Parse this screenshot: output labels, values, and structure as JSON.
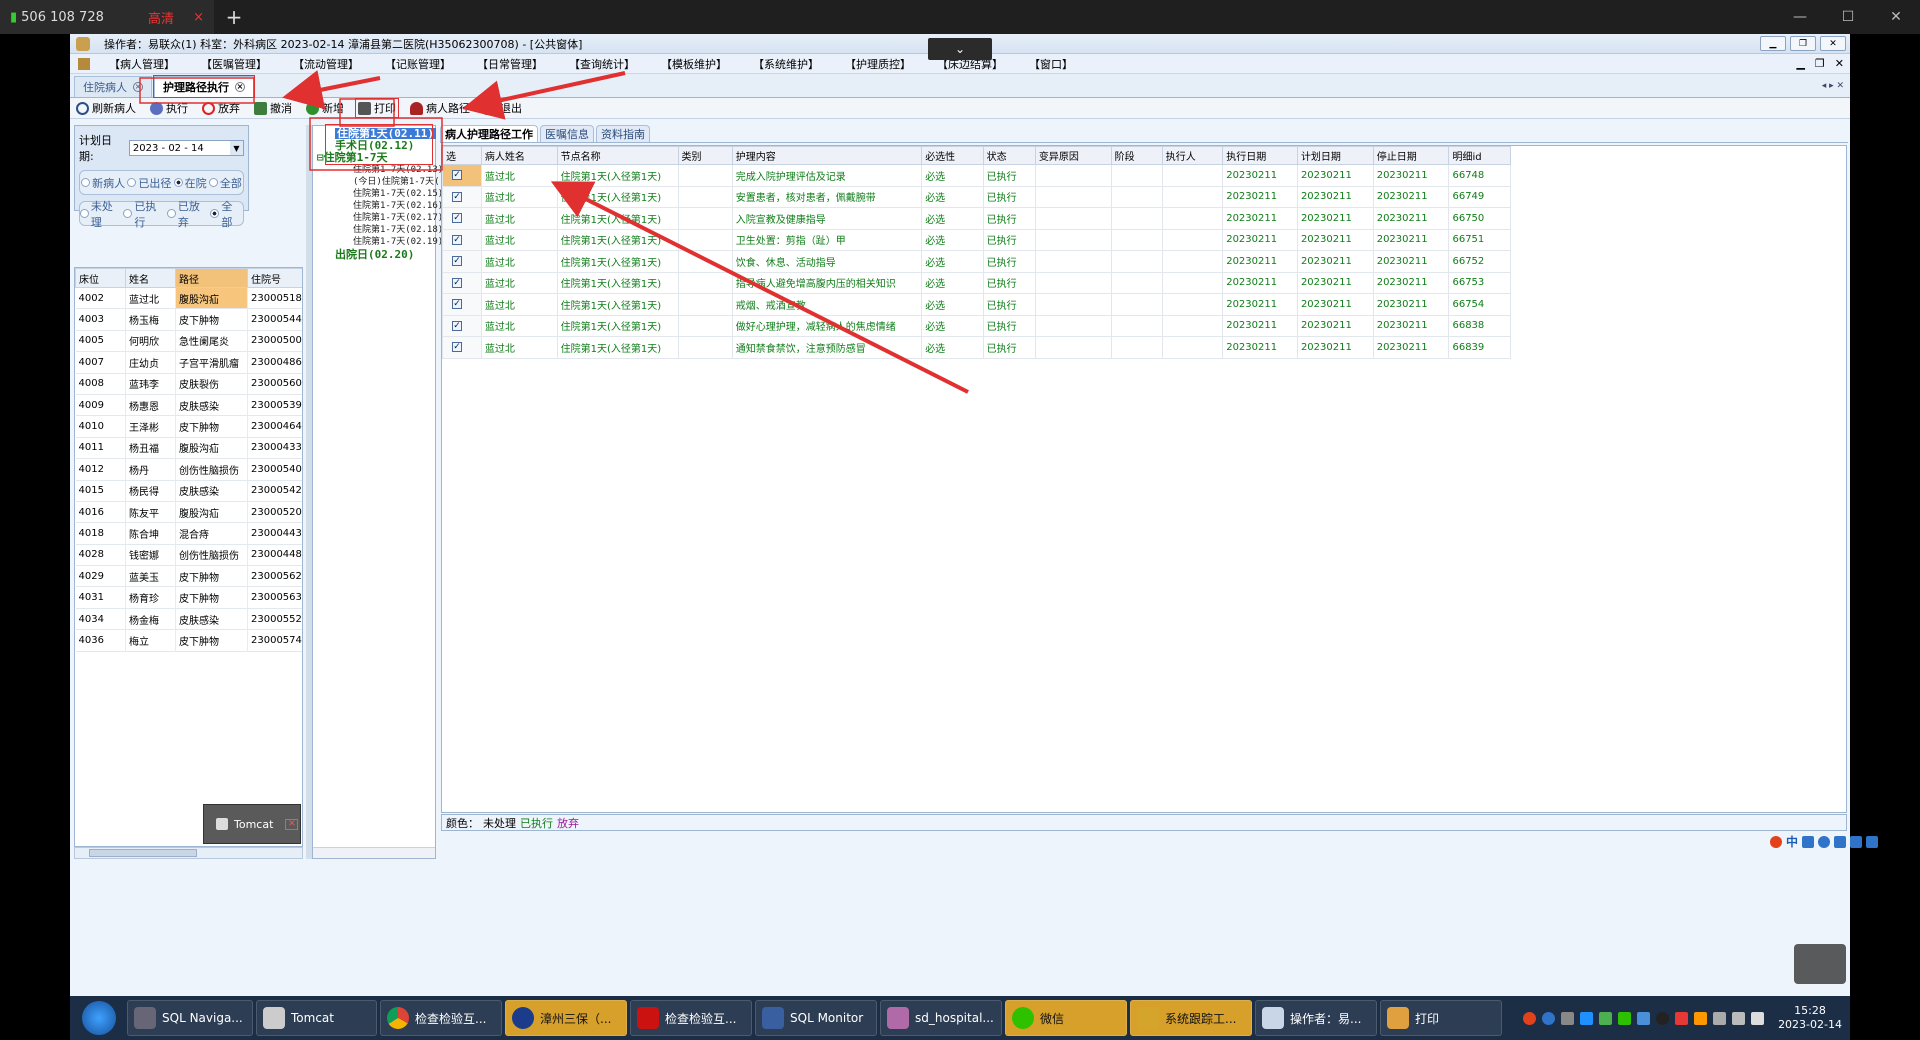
{
  "browser": {
    "tab_signal": "506 108 728",
    "tab_quality": "高清",
    "close": "×",
    "new_tab": "+"
  },
  "app": {
    "title": "操作者：易联众(1)  科室：外科病区  2023-02-14  漳浦县第二医院(H35062300708) - [公共窗体]",
    "menu": [
      "【病人管理】",
      "【医嘱管理】",
      "【流动管理】",
      "【记账管理】",
      "【日常管理】",
      "【查询统计】",
      "【模板维护】",
      "【系统维护】",
      "【护理质控】",
      "【床边结算】",
      "【窗口】"
    ],
    "page_tabs": [
      {
        "label": "住院病人"
      },
      {
        "label": "护理路径执行"
      }
    ],
    "toolbar": [
      "刷新病人",
      "执行",
      "放弃",
      "撤消",
      "新增",
      "打印",
      "病人路径",
      "退出"
    ],
    "filter": {
      "date_label": "计划日期:",
      "date_value": "2023 - 02 - 14",
      "radio1": [
        "新病人",
        "已出径",
        "在院",
        "全部"
      ],
      "radio1_selected": "在院",
      "radio2": [
        "未处理",
        "已执行",
        "已放弃",
        "全部"
      ],
      "radio2_selected": "全部"
    },
    "patients": {
      "headers": [
        "床位",
        "姓名",
        "路径",
        "住院号"
      ],
      "rows": [
        [
          "4002",
          "蓝过北",
          "腹股沟疝",
          "23000518"
        ],
        [
          "4003",
          "杨玉梅",
          "皮下肿物",
          "23000544"
        ],
        [
          "4005",
          "何明欣",
          "急性阑尾炎",
          "23000500"
        ],
        [
          "4007",
          "庄幼贞",
          "子宫平滑肌瘤",
          "23000486"
        ],
        [
          "4008",
          "蓝玮李",
          "皮肤裂伤",
          "23000560"
        ],
        [
          "4009",
          "杨惠恩",
          "皮肤感染",
          "23000539"
        ],
        [
          "4010",
          "王泽彬",
          "皮下肿物",
          "23000464"
        ],
        [
          "4011",
          "杨丑福",
          "腹股沟疝",
          "23000433"
        ],
        [
          "4012",
          "杨丹",
          "创伤性脑损伤",
          "23000540"
        ],
        [
          "4015",
          "杨民得",
          "皮肤感染",
          "23000542"
        ],
        [
          "4016",
          "陈友平",
          "腹股沟疝",
          "23000520"
        ],
        [
          "4018",
          "陈合坤",
          "混合痔",
          "23000443"
        ],
        [
          "4028",
          "钱密娜",
          "创伤性脑损伤",
          "23000448"
        ],
        [
          "4029",
          "蓝美玉",
          "皮下肿物",
          "23000562"
        ],
        [
          "4031",
          "杨育珍",
          "皮下肿物",
          "23000563"
        ],
        [
          "4034",
          "杨金梅",
          "皮肤感染",
          "23000552"
        ],
        [
          "4036",
          "梅立",
          "皮下肿物",
          "23000574"
        ]
      ]
    },
    "tomcat_popup": "Tomcat",
    "tree": {
      "items": [
        "住院第1天(02.11)",
        "手术日(02.12)",
        "住院第1-7天",
        "住院第1-7天(02.13)",
        "(今日)住院第1-7天(",
        "住院第1-7天(02.15)",
        "住院第1-7天(02.16)",
        "住院第1-7天(02.17)",
        "住院第1-7天(02.18)",
        "住院第1-7天(02.19)",
        "出院日(02.20)"
      ]
    },
    "subtabs": [
      "病人护理路径工作",
      "医嘱信息",
      "资料指南"
    ],
    "grid": {
      "headers": [
        "选",
        "病人姓名",
        "节点名称",
        "类别",
        "护理内容",
        "必选性",
        "状态",
        "变异原因",
        "阶段",
        "执行人",
        "执行日期",
        "计划日期",
        "停止日期",
        "明细id"
      ],
      "rows": [
        [
          "✓",
          "蓝过北",
          "住院第1天(入径第1天)",
          "",
          "完成入院护理评估及记录",
          "必选",
          "已执行",
          "",
          "",
          "",
          "20230211",
          "20230211",
          "20230211",
          "66748"
        ],
        [
          "✓",
          "蓝过北",
          "住院第1天(入径第1天)",
          "",
          "安置患者，核对患者，佩戴腕带",
          "必选",
          "已执行",
          "",
          "",
          "",
          "20230211",
          "20230211",
          "20230211",
          "66749"
        ],
        [
          "✓",
          "蓝过北",
          "住院第1天(入径第1天)",
          "",
          "入院宣教及健康指导",
          "必选",
          "已执行",
          "",
          "",
          "",
          "20230211",
          "20230211",
          "20230211",
          "66750"
        ],
        [
          "✓",
          "蓝过北",
          "住院第1天(入径第1天)",
          "",
          "卫生处置：剪指（趾）甲",
          "必选",
          "已执行",
          "",
          "",
          "",
          "20230211",
          "20230211",
          "20230211",
          "66751"
        ],
        [
          "✓",
          "蓝过北",
          "住院第1天(入径第1天)",
          "",
          "饮食、休息、活动指导",
          "必选",
          "已执行",
          "",
          "",
          "",
          "20230211",
          "20230211",
          "20230211",
          "66752"
        ],
        [
          "✓",
          "蓝过北",
          "住院第1天(入径第1天)",
          "",
          "指导病人避免增高腹内压的相关知识",
          "必选",
          "已执行",
          "",
          "",
          "",
          "20230211",
          "20230211",
          "20230211",
          "66753"
        ],
        [
          "✓",
          "蓝过北",
          "住院第1天(入径第1天)",
          "",
          "戒烟、戒酒宣教",
          "必选",
          "已执行",
          "",
          "",
          "",
          "20230211",
          "20230211",
          "20230211",
          "66754"
        ],
        [
          "✓",
          "蓝过北",
          "住院第1天(入径第1天)",
          "",
          "做好心理护理，减轻病人的焦虑情绪",
          "必选",
          "已执行",
          "",
          "",
          "",
          "20230211",
          "20230211",
          "20230211",
          "66838"
        ],
        [
          "✓",
          "蓝过北",
          "住院第1天(入径第1天)",
          "",
          "通知禁食禁饮，注意预防感冒",
          "必选",
          "已执行",
          "",
          "",
          "",
          "20230211",
          "20230211",
          "20230211",
          "66839"
        ]
      ]
    },
    "legend": {
      "prefix": "颜色：",
      "pending": "未处理",
      "executed": "已执行",
      "given_up": "放弃"
    }
  },
  "taskbar": {
    "items": [
      "SQL Naviga...",
      "Tomcat",
      "检查检验互...",
      "漳州三保（...",
      "检查检验互...",
      "SQL Monitor",
      "sd_hospital...",
      "微信",
      "系统跟踪工...",
      "操作者：易...",
      "打印"
    ],
    "clock_time": "15:28",
    "clock_date": "2023-02-14",
    "ime": "中"
  },
  "colors": {
    "executed_green": "#0f7d18",
    "annotation_red": "#e03030",
    "accent_blue": "#3b7ad6"
  }
}
